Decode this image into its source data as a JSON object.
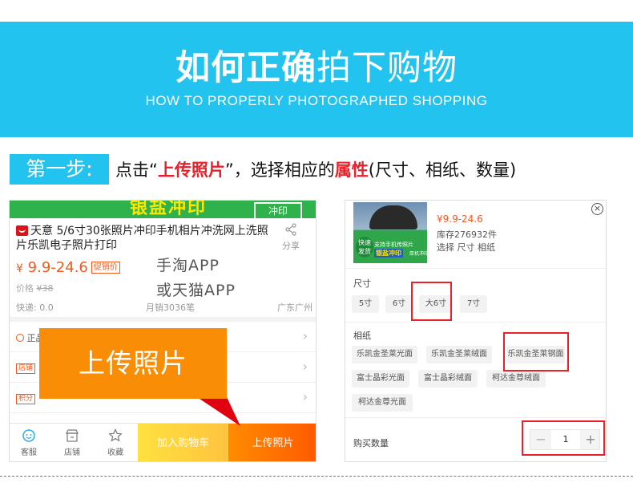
{
  "banner": {
    "title_bold": "如何正确",
    "title_rest": "拍下购物",
    "subtitle": "HOW TO PROPERLY PHOTOGRAPHED SHOPPING",
    "bg_color": "#22c3ee"
  },
  "step": {
    "badge": "第一步:",
    "text_before": "点击“",
    "text_highlight1": "上传照片",
    "text_middle": "”，选择相应的",
    "text_highlight2": "属性",
    "text_after": "(尺寸、相纸、数量)"
  },
  "left_panel": {
    "banner_text": "银盐冲印",
    "banner_tag": "冲印",
    "product_title": "天意 5/6寸30张照片冲印手机相片冲洗网上洗照片乐凯电子照片打印",
    "share_label": "分享",
    "price_symbol": "¥",
    "price_main": "9.",
    "price_rest": "9-24.6",
    "promo_badge": "促销价",
    "orig_price_label": "价格",
    "orig_price": "¥38",
    "app_hint_1": "手淘APP",
    "app_hint_2": "或天猫APP",
    "shipping": "快递: 0.0",
    "monthly_sales": "月销3036笔",
    "location": "广东广州",
    "row1_label": "正品",
    "row2_label": "店铺",
    "row3_label": "积分",
    "bottom_bar": {
      "service": "客服",
      "store": "店铺",
      "favorite": "收藏",
      "add_cart": "加入购物车",
      "upload": "上传照片"
    }
  },
  "callout": {
    "text": "上传照片",
    "color": "#f98d05"
  },
  "right_panel": {
    "thumb": {
      "badge": "快速发货",
      "line1": "支持手机传照片",
      "line2": "银盐冲印",
      "line2_tag": "厚机冲印"
    },
    "price": "¥9.9-24.6",
    "stock": "库存276932件",
    "select_hint": "选择 尺寸 相纸",
    "size_label": "尺寸",
    "sizes": [
      "5寸",
      "6寸",
      "大6寸",
      "7寸"
    ],
    "paper_label": "相纸",
    "papers": [
      "乐凯金圣莱光面",
      "乐凯金圣莱绒面",
      "乐凯金圣莱钢面",
      "富士晶彩光面",
      "富士晶彩绒面",
      "柯达金尊绒面",
      "柯达金尊光面"
    ],
    "qty_label": "购买数量",
    "qty_value": "1",
    "highlight_color": "#e8212a"
  }
}
